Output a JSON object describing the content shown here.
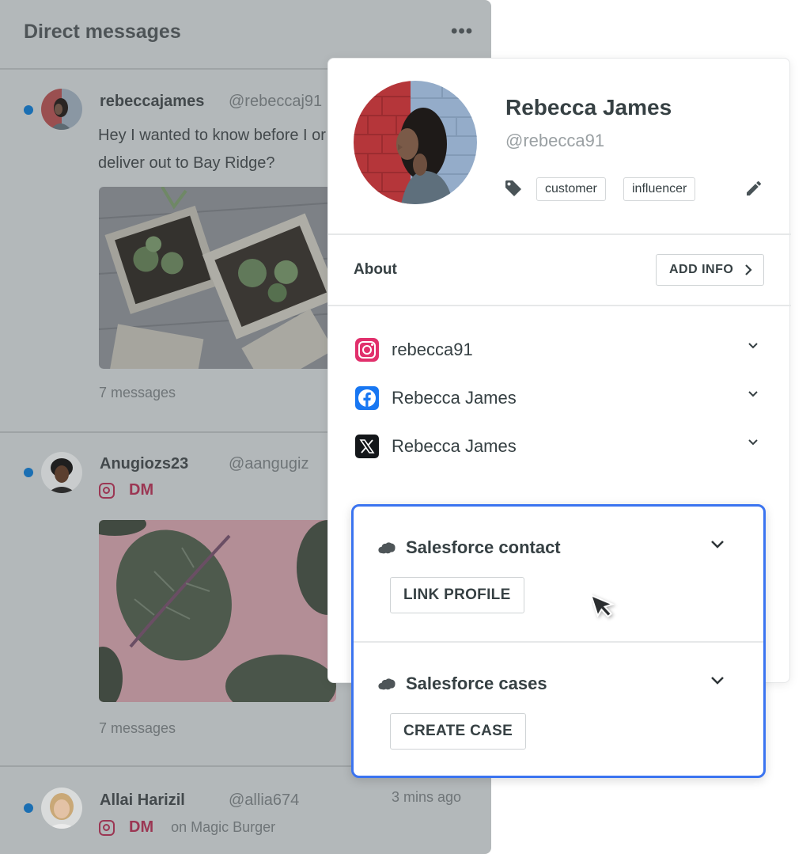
{
  "dm_panel": {
    "title": "Direct messages",
    "more_glyph": "•••",
    "conversations": [
      {
        "name": "rebeccajames",
        "handle": "@rebeccaj91",
        "message_line1": "Hey I wanted to know before I or",
        "message_line2": "deliver out to Bay Ridge?",
        "count": "7 messages",
        "unread": true
      },
      {
        "name": "Anugiozs23",
        "handle": "@aangugiz",
        "channel": "DM",
        "count": "7 messages",
        "unread": true
      },
      {
        "name": "Allai Harizil",
        "handle": "@allia674",
        "channel": "DM",
        "on": "on Magic Burger",
        "time": "3 mins ago",
        "unread": true
      }
    ]
  },
  "profile": {
    "name": "Rebecca James",
    "handle": "@rebecca91",
    "tags": [
      "customer",
      "influencer"
    ],
    "about_label": "About",
    "add_info_label": "ADD INFO",
    "social": [
      {
        "network": "instagram",
        "icon": "instagram-icon",
        "label": "rebecca91"
      },
      {
        "network": "facebook",
        "icon": "facebook-icon",
        "label": "Rebecca James"
      },
      {
        "network": "x",
        "icon": "x-icon",
        "label": "Rebecca James"
      }
    ]
  },
  "salesforce": {
    "contact_title": "Salesforce contact",
    "link_profile_label": "LINK PROFILE",
    "cases_title": "Salesforce cases",
    "create_case_label": "CREATE CASE"
  },
  "colors": {
    "accent_blue": "#3b74f0",
    "instagram": "#e1306c",
    "facebook": "#1877f2",
    "unread_dot": "#1b6fb3",
    "dm_label": "#9b3653"
  }
}
